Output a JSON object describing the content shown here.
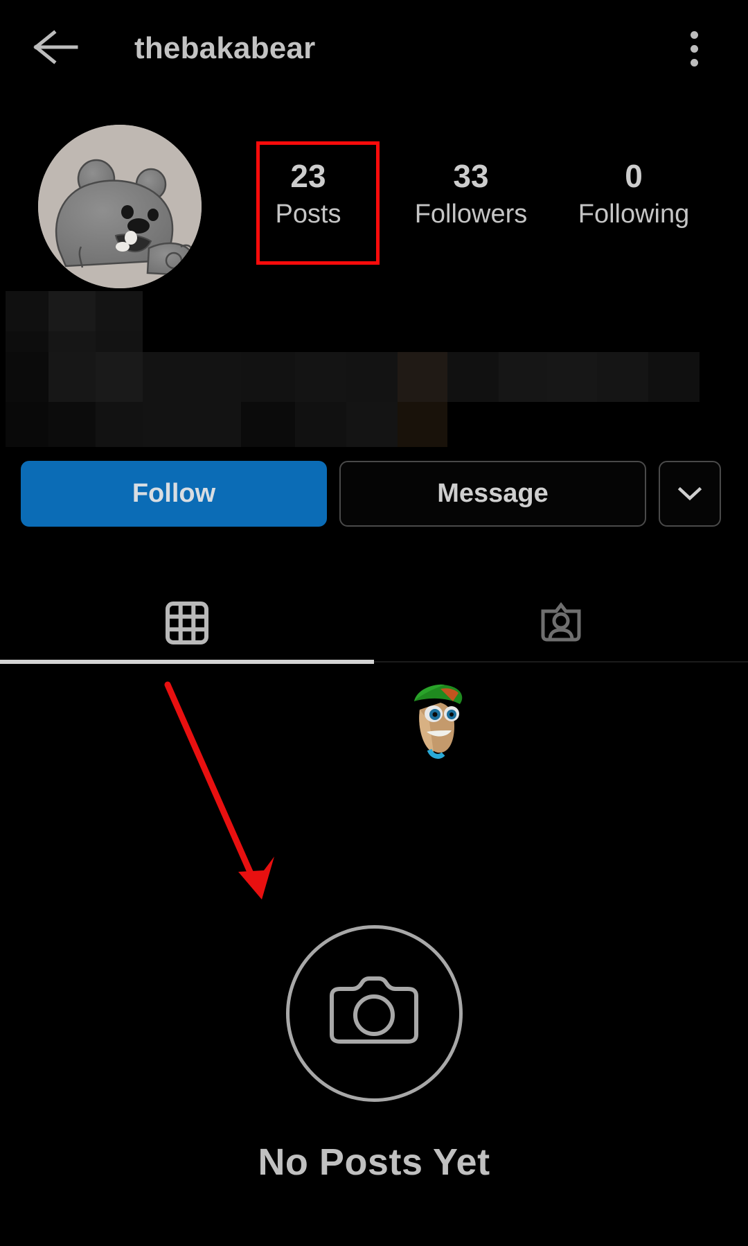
{
  "appbar": {
    "back_icon": "arrow-left-icon",
    "title": "thebakabear",
    "menu_icon": "kebab-menu-icon"
  },
  "profile": {
    "avatar_alt": "bear-cartoon-avatar",
    "bio_blurred": true,
    "stats": [
      {
        "value": "23",
        "label": "Posts",
        "name": "posts"
      },
      {
        "value": "33",
        "label": "Followers",
        "name": "followers"
      },
      {
        "value": "0",
        "label": "Following",
        "name": "following"
      }
    ]
  },
  "actions": {
    "follow_label": "Follow",
    "message_label": "Message",
    "more_icon": "chevron-down-icon"
  },
  "tabs": [
    {
      "label": "Grid",
      "icon": "grid-icon",
      "active": true
    },
    {
      "label": "Tagged",
      "icon": "tagged-person-icon",
      "active": false
    }
  ],
  "content": {
    "sticker_icon": "cartoon-face-sticker",
    "empty_icon": "camera-circle-icon",
    "empty_title": "No Posts Yet"
  },
  "annotations": {
    "highlight_color": "#fb0b0b",
    "highlight_target": "posts-stat",
    "arrow_color": "#e81010",
    "arrow_from": "240,988",
    "arrow_to": "378,1296"
  },
  "colors": {
    "background": "#000000",
    "follow_blue": "#0b6cb6",
    "text_primary": "#c7c7c7",
    "accent_red": "#fb0b0b"
  }
}
